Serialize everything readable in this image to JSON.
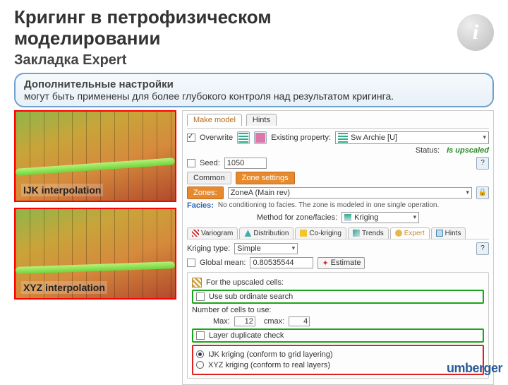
{
  "title_line1": "Кригинг в петрофизическом",
  "title_line2": "моделировании",
  "subtitle": "Закладка Expert",
  "callout": {
    "heading": "Дополнительные настройки",
    "body": "могут быть применены для более глубокого контроля над результатом кригинга."
  },
  "figs": {
    "ijk": "IJK interpolation",
    "xyz": "XYZ  interpolation"
  },
  "panel": {
    "tabs_top": {
      "make_model": "Make model",
      "hints": "Hints"
    },
    "overwrite": "Overwrite",
    "existing_property_label": "Existing property:",
    "existing_property_value": "Sw Archie [U]",
    "status_label": "Status:",
    "status_value": "Is upscaled",
    "seed_label": "Seed:",
    "seed_value": "1050",
    "common": "Common",
    "zone_settings": "Zone settings",
    "zones_label": "Zones:",
    "zone_value": "ZoneA (Main rev)",
    "facies_label": "Facies:",
    "facies_note": "No conditioning to facies. The zone is modeled in one single operation.",
    "method_label": "Method for zone/facies:",
    "method_value": "Kriging",
    "subtabs": {
      "variogram": "Variogram",
      "distribution": "Distribution",
      "cokriging": "Co-kriging",
      "trends": "Trends",
      "expert": "Expert",
      "hints": "Hints"
    },
    "kriging_type_label": "Kriging type:",
    "kriging_type_value": "Simple",
    "global_mean_label": "Global mean:",
    "global_mean_value": "0.80535544",
    "estimate": "Estimate",
    "for_upscaled": "For the upscaled cells:",
    "sub_search": "Use sub ordinate search",
    "num_cells_label": "Number of cells to use:",
    "num_cells_max": "Max:",
    "num_cells_max_v": "12",
    "num_cells_cmax": "cmax:",
    "num_cells_cmax_v": "4",
    "layer_dup": "Layer duplicate check",
    "ijk_kriging": "IJK kriging (conform to grid layering)",
    "xyz_kriging": "XYZ kriging (conform to real layers)"
  },
  "logo": "umberger"
}
